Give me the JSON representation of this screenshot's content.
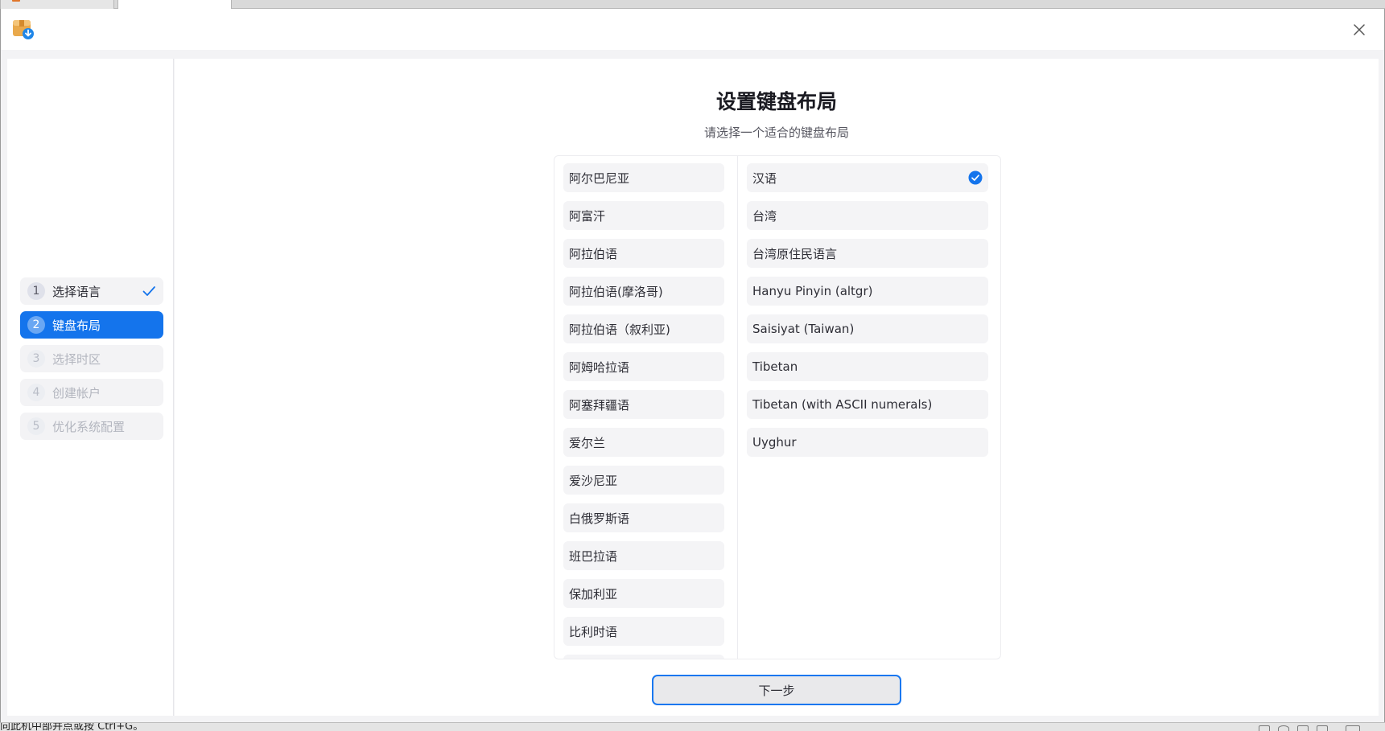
{
  "window": {
    "title": "",
    "close_icon": "close-icon",
    "app_icon": "package-download-icon"
  },
  "sidebar": {
    "steps": [
      {
        "num": "1",
        "label": "选择语言",
        "state": "done"
      },
      {
        "num": "2",
        "label": "键盘布局",
        "state": "active"
      },
      {
        "num": "3",
        "label": "选择时区",
        "state": "disabled"
      },
      {
        "num": "4",
        "label": "创建帐户",
        "state": "disabled"
      },
      {
        "num": "5",
        "label": "优化系统配置",
        "state": "disabled"
      }
    ]
  },
  "main": {
    "title": "设置键盘布局",
    "subtitle": "请选择一个适合的键盘布局",
    "languages": [
      "阿尔巴尼亚",
      "阿富汗",
      "阿拉伯语",
      "阿拉伯语(摩洛哥)",
      "阿拉伯语（叙利亚)",
      "阿姆哈拉语",
      "阿塞拜疆语",
      "爱尔兰",
      "爱沙尼亚",
      "白俄罗斯语",
      "班巴拉语",
      "保加利亚",
      "比利时语"
    ],
    "variants": [
      {
        "label": "汉语",
        "selected": true
      },
      {
        "label": "台湾",
        "selected": false
      },
      {
        "label": "台湾原住民语言",
        "selected": false
      },
      {
        "label": "Hanyu Pinyin (altgr)",
        "selected": false
      },
      {
        "label": "Saisiyat (Taiwan)",
        "selected": false
      },
      {
        "label": "Tibetan",
        "selected": false
      },
      {
        "label": "Tibetan (with ASCII numerals)",
        "selected": false
      },
      {
        "label": "Uyghur",
        "selected": false
      }
    ],
    "next_label": "下一步"
  },
  "colors": {
    "accent": "#1474ec",
    "panel": "#ffffff",
    "item_bg": "#f4f4f6"
  },
  "host": {
    "status_text": "向此机中部并点或按 Ctrl+G。"
  }
}
